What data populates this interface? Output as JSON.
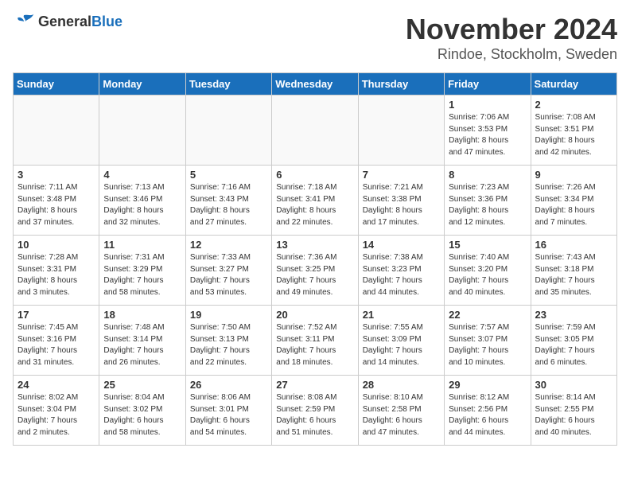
{
  "logo": {
    "general": "General",
    "blue": "Blue"
  },
  "header": {
    "month": "November 2024",
    "location": "Rindoe, Stockholm, Sweden"
  },
  "weekdays": [
    "Sunday",
    "Monday",
    "Tuesday",
    "Wednesday",
    "Thursday",
    "Friday",
    "Saturday"
  ],
  "weeks": [
    [
      {
        "day": "",
        "info": ""
      },
      {
        "day": "",
        "info": ""
      },
      {
        "day": "",
        "info": ""
      },
      {
        "day": "",
        "info": ""
      },
      {
        "day": "",
        "info": ""
      },
      {
        "day": "1",
        "info": "Sunrise: 7:06 AM\nSunset: 3:53 PM\nDaylight: 8 hours\nand 47 minutes."
      },
      {
        "day": "2",
        "info": "Sunrise: 7:08 AM\nSunset: 3:51 PM\nDaylight: 8 hours\nand 42 minutes."
      }
    ],
    [
      {
        "day": "3",
        "info": "Sunrise: 7:11 AM\nSunset: 3:48 PM\nDaylight: 8 hours\nand 37 minutes."
      },
      {
        "day": "4",
        "info": "Sunrise: 7:13 AM\nSunset: 3:46 PM\nDaylight: 8 hours\nand 32 minutes."
      },
      {
        "day": "5",
        "info": "Sunrise: 7:16 AM\nSunset: 3:43 PM\nDaylight: 8 hours\nand 27 minutes."
      },
      {
        "day": "6",
        "info": "Sunrise: 7:18 AM\nSunset: 3:41 PM\nDaylight: 8 hours\nand 22 minutes."
      },
      {
        "day": "7",
        "info": "Sunrise: 7:21 AM\nSunset: 3:38 PM\nDaylight: 8 hours\nand 17 minutes."
      },
      {
        "day": "8",
        "info": "Sunrise: 7:23 AM\nSunset: 3:36 PM\nDaylight: 8 hours\nand 12 minutes."
      },
      {
        "day": "9",
        "info": "Sunrise: 7:26 AM\nSunset: 3:34 PM\nDaylight: 8 hours\nand 7 minutes."
      }
    ],
    [
      {
        "day": "10",
        "info": "Sunrise: 7:28 AM\nSunset: 3:31 PM\nDaylight: 8 hours\nand 3 minutes."
      },
      {
        "day": "11",
        "info": "Sunrise: 7:31 AM\nSunset: 3:29 PM\nDaylight: 7 hours\nand 58 minutes."
      },
      {
        "day": "12",
        "info": "Sunrise: 7:33 AM\nSunset: 3:27 PM\nDaylight: 7 hours\nand 53 minutes."
      },
      {
        "day": "13",
        "info": "Sunrise: 7:36 AM\nSunset: 3:25 PM\nDaylight: 7 hours\nand 49 minutes."
      },
      {
        "day": "14",
        "info": "Sunrise: 7:38 AM\nSunset: 3:23 PM\nDaylight: 7 hours\nand 44 minutes."
      },
      {
        "day": "15",
        "info": "Sunrise: 7:40 AM\nSunset: 3:20 PM\nDaylight: 7 hours\nand 40 minutes."
      },
      {
        "day": "16",
        "info": "Sunrise: 7:43 AM\nSunset: 3:18 PM\nDaylight: 7 hours\nand 35 minutes."
      }
    ],
    [
      {
        "day": "17",
        "info": "Sunrise: 7:45 AM\nSunset: 3:16 PM\nDaylight: 7 hours\nand 31 minutes."
      },
      {
        "day": "18",
        "info": "Sunrise: 7:48 AM\nSunset: 3:14 PM\nDaylight: 7 hours\nand 26 minutes."
      },
      {
        "day": "19",
        "info": "Sunrise: 7:50 AM\nSunset: 3:13 PM\nDaylight: 7 hours\nand 22 minutes."
      },
      {
        "day": "20",
        "info": "Sunrise: 7:52 AM\nSunset: 3:11 PM\nDaylight: 7 hours\nand 18 minutes."
      },
      {
        "day": "21",
        "info": "Sunrise: 7:55 AM\nSunset: 3:09 PM\nDaylight: 7 hours\nand 14 minutes."
      },
      {
        "day": "22",
        "info": "Sunrise: 7:57 AM\nSunset: 3:07 PM\nDaylight: 7 hours\nand 10 minutes."
      },
      {
        "day": "23",
        "info": "Sunrise: 7:59 AM\nSunset: 3:05 PM\nDaylight: 7 hours\nand 6 minutes."
      }
    ],
    [
      {
        "day": "24",
        "info": "Sunrise: 8:02 AM\nSunset: 3:04 PM\nDaylight: 7 hours\nand 2 minutes."
      },
      {
        "day": "25",
        "info": "Sunrise: 8:04 AM\nSunset: 3:02 PM\nDaylight: 6 hours\nand 58 minutes."
      },
      {
        "day": "26",
        "info": "Sunrise: 8:06 AM\nSunset: 3:01 PM\nDaylight: 6 hours\nand 54 minutes."
      },
      {
        "day": "27",
        "info": "Sunrise: 8:08 AM\nSunset: 2:59 PM\nDaylight: 6 hours\nand 51 minutes."
      },
      {
        "day": "28",
        "info": "Sunrise: 8:10 AM\nSunset: 2:58 PM\nDaylight: 6 hours\nand 47 minutes."
      },
      {
        "day": "29",
        "info": "Sunrise: 8:12 AM\nSunset: 2:56 PM\nDaylight: 6 hours\nand 44 minutes."
      },
      {
        "day": "30",
        "info": "Sunrise: 8:14 AM\nSunset: 2:55 PM\nDaylight: 6 hours\nand 40 minutes."
      }
    ]
  ]
}
